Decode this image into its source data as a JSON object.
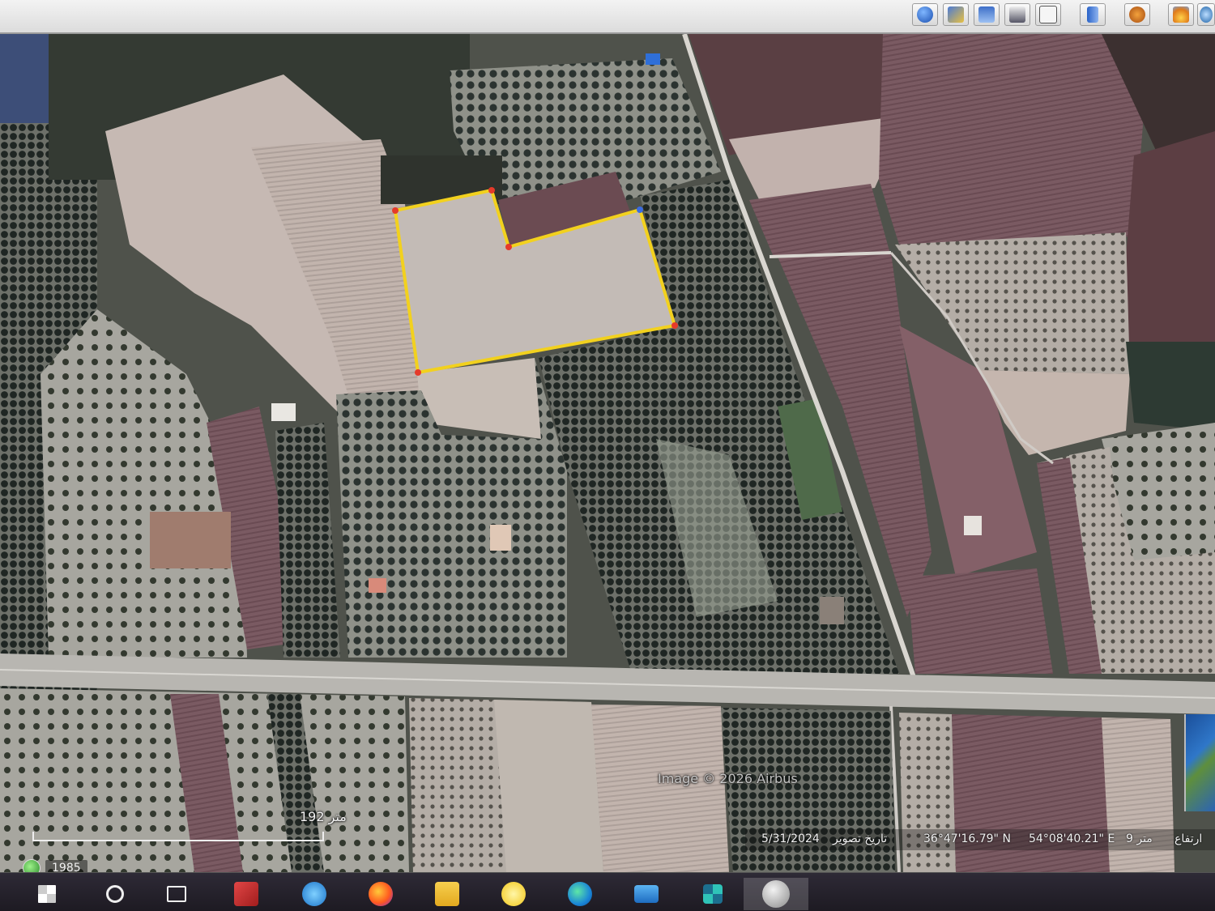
{
  "app": {
    "toolbar_icons": [
      "globe-icon",
      "image-overlay-icon",
      "save-image-icon",
      "print-icon",
      "email-icon",
      "ruler-icon",
      "planet-icon",
      "sun-icon",
      "sky-icon"
    ],
    "accent": "#f2d11e"
  },
  "map": {
    "attribution": "Image © 2026 Airbus",
    "scale_label": "192 متر",
    "imagery_date_label": "تاريخ تصوير",
    "imagery_date": "5/31/2024",
    "latitude": "36°47'16.79\" N",
    "longitude": "54°08'40.21\" E",
    "elevation_value": "9 متر",
    "elevation_label": "ارتفاع",
    "historical_year": "1985",
    "polygon_color": "#f2d11e",
    "vertex_color": "#e53a2a"
  },
  "taskbar": {
    "icons": [
      "windows-start-icon",
      "search-icon",
      "task-view-icon",
      "mail-app-icon",
      "internet-explorer-icon",
      "firefox-icon",
      "file-explorer-icon",
      "remote-app-icon",
      "edge-icon",
      "computer-icon",
      "app-grid-icon",
      "google-earth-pro-icon"
    ]
  }
}
